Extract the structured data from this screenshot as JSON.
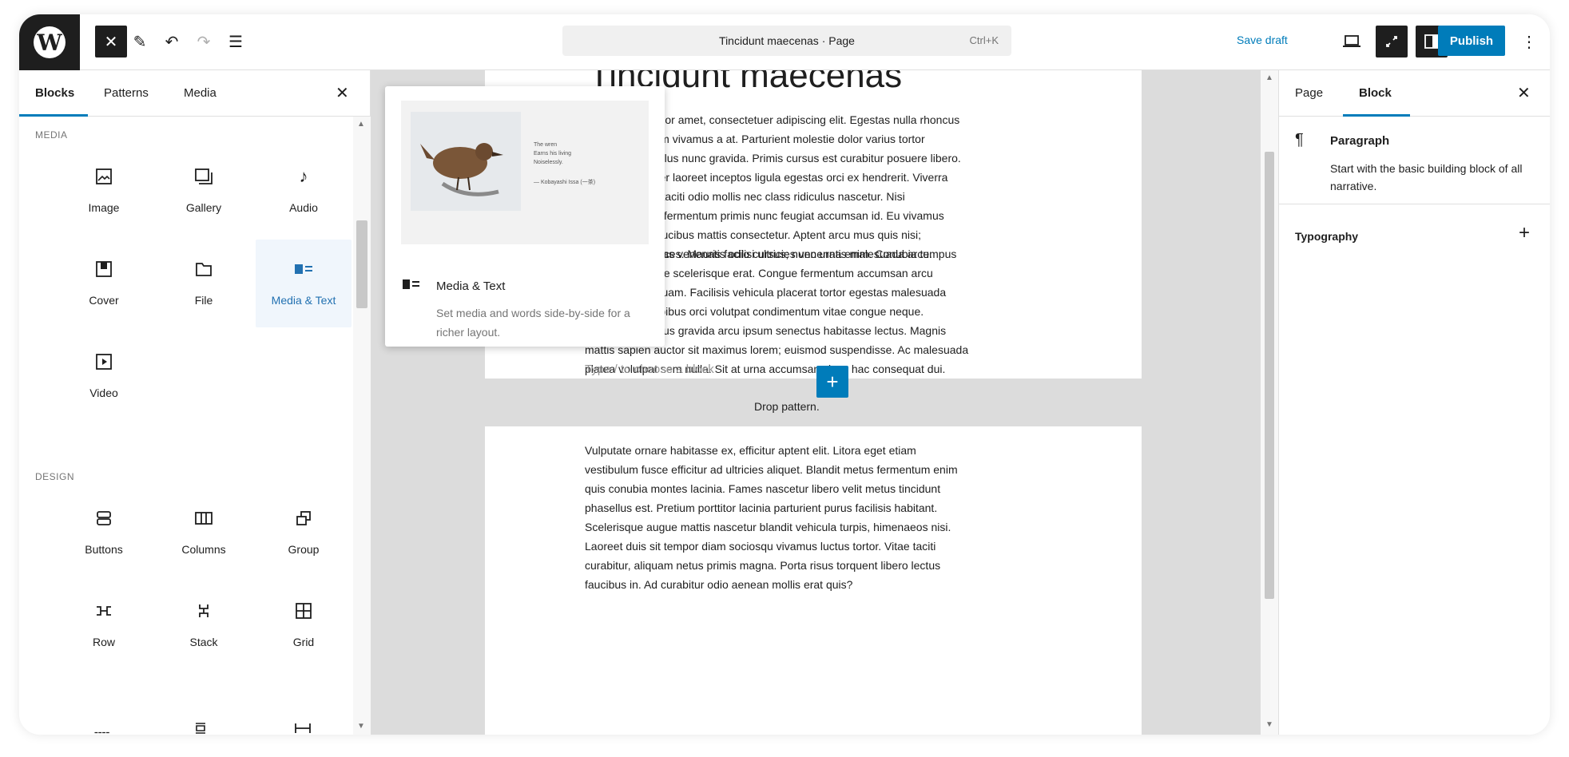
{
  "topbar": {
    "doc_title": "Tincidunt maecenas · Page",
    "shortcut": "Ctrl+K",
    "save_draft": "Save draft",
    "publish": "Publish"
  },
  "inserter": {
    "tabs": [
      "Blocks",
      "Patterns",
      "Media"
    ],
    "categories": {
      "media": "MEDIA",
      "design": "DESIGN"
    },
    "media_blocks": [
      {
        "label": "Image",
        "icon": "image-icon"
      },
      {
        "label": "Gallery",
        "icon": "gallery-icon"
      },
      {
        "label": "Audio",
        "icon": "audio-icon"
      },
      {
        "label": "Cover",
        "icon": "cover-icon"
      },
      {
        "label": "File",
        "icon": "file-icon"
      },
      {
        "label": "Media & Text",
        "icon": "media-text-icon"
      },
      {
        "label": "Video",
        "icon": "video-icon"
      }
    ],
    "design_blocks": [
      {
        "label": "Buttons",
        "icon": "buttons-icon"
      },
      {
        "label": "Columns",
        "icon": "columns-icon"
      },
      {
        "label": "Group",
        "icon": "group-icon"
      },
      {
        "label": "Row",
        "icon": "row-icon"
      },
      {
        "label": "Stack",
        "icon": "stack-icon"
      },
      {
        "label": "Grid",
        "icon": "grid-icon"
      }
    ]
  },
  "preview": {
    "title": "Media & Text",
    "description": "Set media and words side-by-side for a richer layout.",
    "poem": [
      "The wren",
      "Earns his living",
      "Noiselessly.",
      "— Kobayashi Issa (一茶)"
    ]
  },
  "canvas": {
    "heading": "Tincidunt maecenas",
    "para1": [
      "Lorem ipsum odor amet, consectetuer adipiscing elit. Egestas nulla rhoncus",
      "quam fermentum vivamus a at. Parturient molestie dolor varius tortor",
      "interdum phasellus nunc gravida. Primis cursus est curabitur posuere libero.",
      "Tristique felis per laoreet inceptos ligula egestas orci ex hendrerit. Viverra",
      "netus curabitur taciti odio mollis nec class ridiculus nascetur. Nisi",
      "iaculis faucibus fermentum primis nunc feugiat accumsan id. Eu vivamus",
      "class dictum, faucibus mattis consectetur. Aptent arcu mus quis nisi;",
      "integer duis ultrices. Mauris facilisi ultricies venenatis malesuada arcu."
    ],
    "para2": [
      "Nullam maecenas venenatis odio cursus; nunc urna enim. Conubia tempus",
      "posuere molestie scelerisque erat. Congue fermentum accumsan arcu",
      "tempus nisl aliquam. Facilisis vehicula placerat tortor egestas malesuada",
      "arcu luctus. Dapibus orci volutpat condimentum vitae congue neque.",
      "Hendrerit ridiculus gravida arcu ipsum senectus habitasse lectus. Magnis",
      "mattis sapien auctor sit maximus lorem; euismod suspendisse. Ac malesuada",
      "platea volutpat sem nulla. Sit at urna accumsan class hac consequat dui."
    ],
    "placeholder": "Type / to choose a block",
    "drop_label": "Drop pattern.",
    "para3": [
      "Vulputate ornare habitasse ex, efficitur aptent elit. Litora eget etiam",
      "vestibulum fusce efficitur ad ultricies aliquet. Blandit metus fermentum enim",
      "quis conubia montes lacinia. Fames nascetur libero velit metus tincidunt",
      "phasellus est. Pretium porttitor lacinia parturient purus facilisis habitant.",
      "Scelerisque augue mattis nascetur blandit vehicula turpis, himenaeos nisi.",
      "Laoreet duis sit tempor diam sociosqu vivamus luctus tortor. Vitae taciti",
      "curabitur, aliquam netus primis magna. Porta risus torquent libero lectus",
      "faucibus in. Ad curabitur odio aenean mollis erat quis?"
    ]
  },
  "sidebar": {
    "tabs": [
      "Page",
      "Block"
    ],
    "block_name": "Paragraph",
    "block_desc": "Start with the basic building block of all narrative.",
    "typography": "Typography"
  }
}
